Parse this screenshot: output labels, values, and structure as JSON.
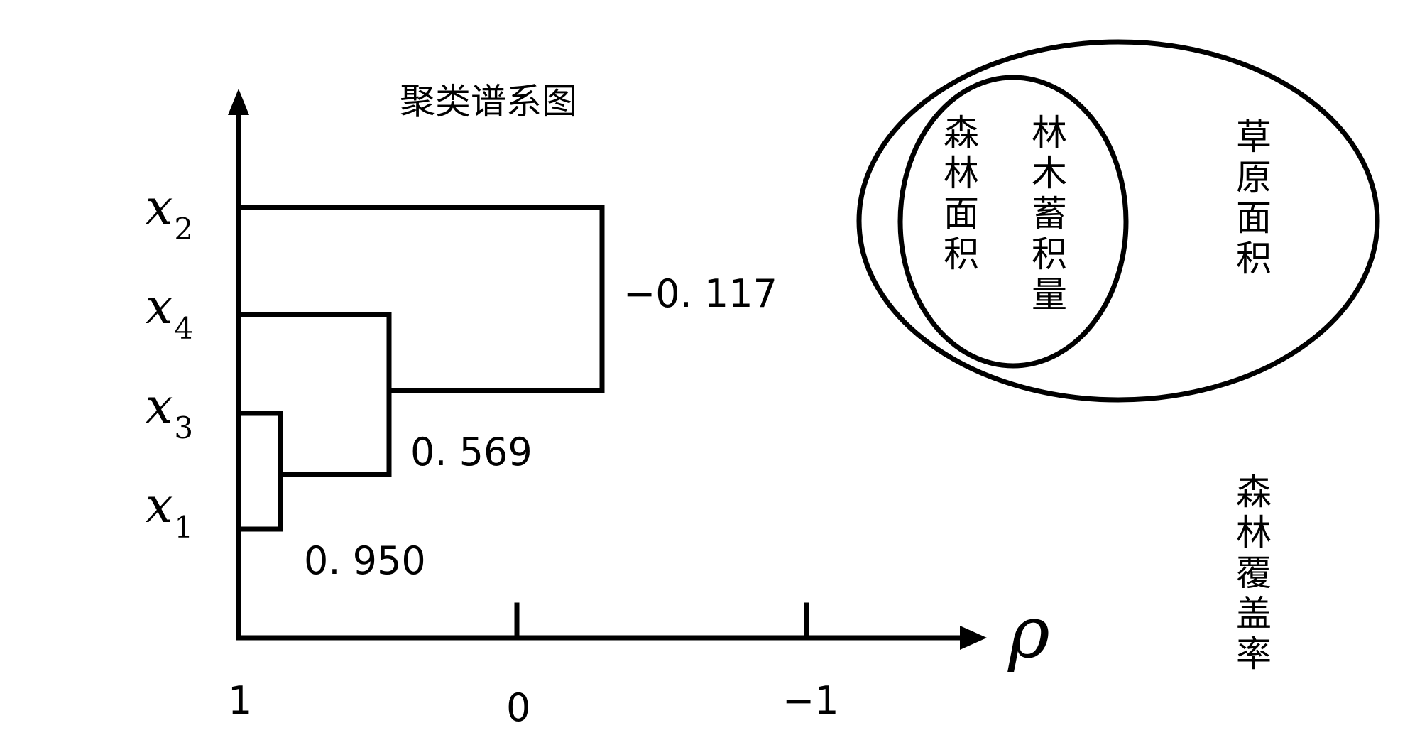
{
  "dendrogram": {
    "title": "聚类谱系图",
    "axis": {
      "symbol": "ρ",
      "ticks": [
        "1",
        "0",
        "−1"
      ]
    },
    "leaves": [
      {
        "base": "x",
        "sub": "2"
      },
      {
        "base": "x",
        "sub": "4"
      },
      {
        "base": "x",
        "sub": "3"
      },
      {
        "base": "x",
        "sub": "1"
      }
    ],
    "merges": [
      {
        "members": [
          "x1",
          "x3"
        ],
        "value": "0. 950"
      },
      {
        "members": [
          "x1",
          "x3",
          "x4"
        ],
        "value": "0. 569"
      },
      {
        "members": [
          "x1",
          "x3",
          "x4",
          "x2"
        ],
        "value": "−0. 117"
      }
    ]
  },
  "venn": {
    "outer_label": "草原面积",
    "inner_left_label": "森林面积",
    "inner_right_label": "林木蓄积量",
    "outside_label": "森林覆盖率"
  }
}
